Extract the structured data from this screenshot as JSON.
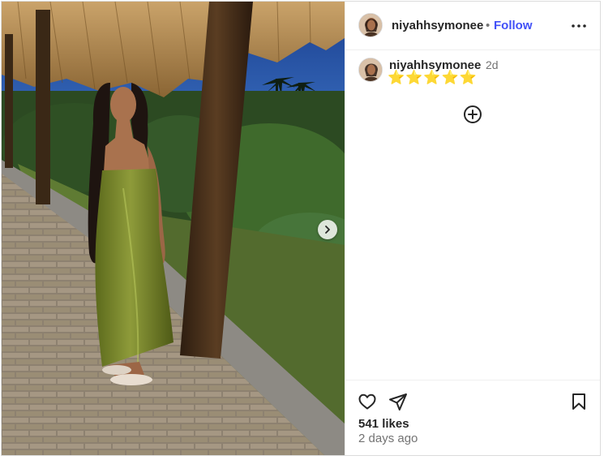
{
  "post": {
    "author": "niyahhsymonee",
    "separator": "•",
    "follow_label": "Follow",
    "caption_author": "niyahhsymonee",
    "caption_time": "2d",
    "caption_text": "⭐⭐⭐⭐⭐",
    "likes": "541 likes",
    "date": "2 days ago"
  },
  "icons": {
    "more": "more-options-icon",
    "next": "chevron-right-icon",
    "load_more": "plus-circle-icon",
    "like": "heart-icon",
    "share": "paper-plane-icon",
    "save": "bookmark-icon"
  },
  "colors": {
    "follow": "#4150f7",
    "username": "#262626",
    "secondary": "#737373",
    "border": "#dbdbdb"
  }
}
